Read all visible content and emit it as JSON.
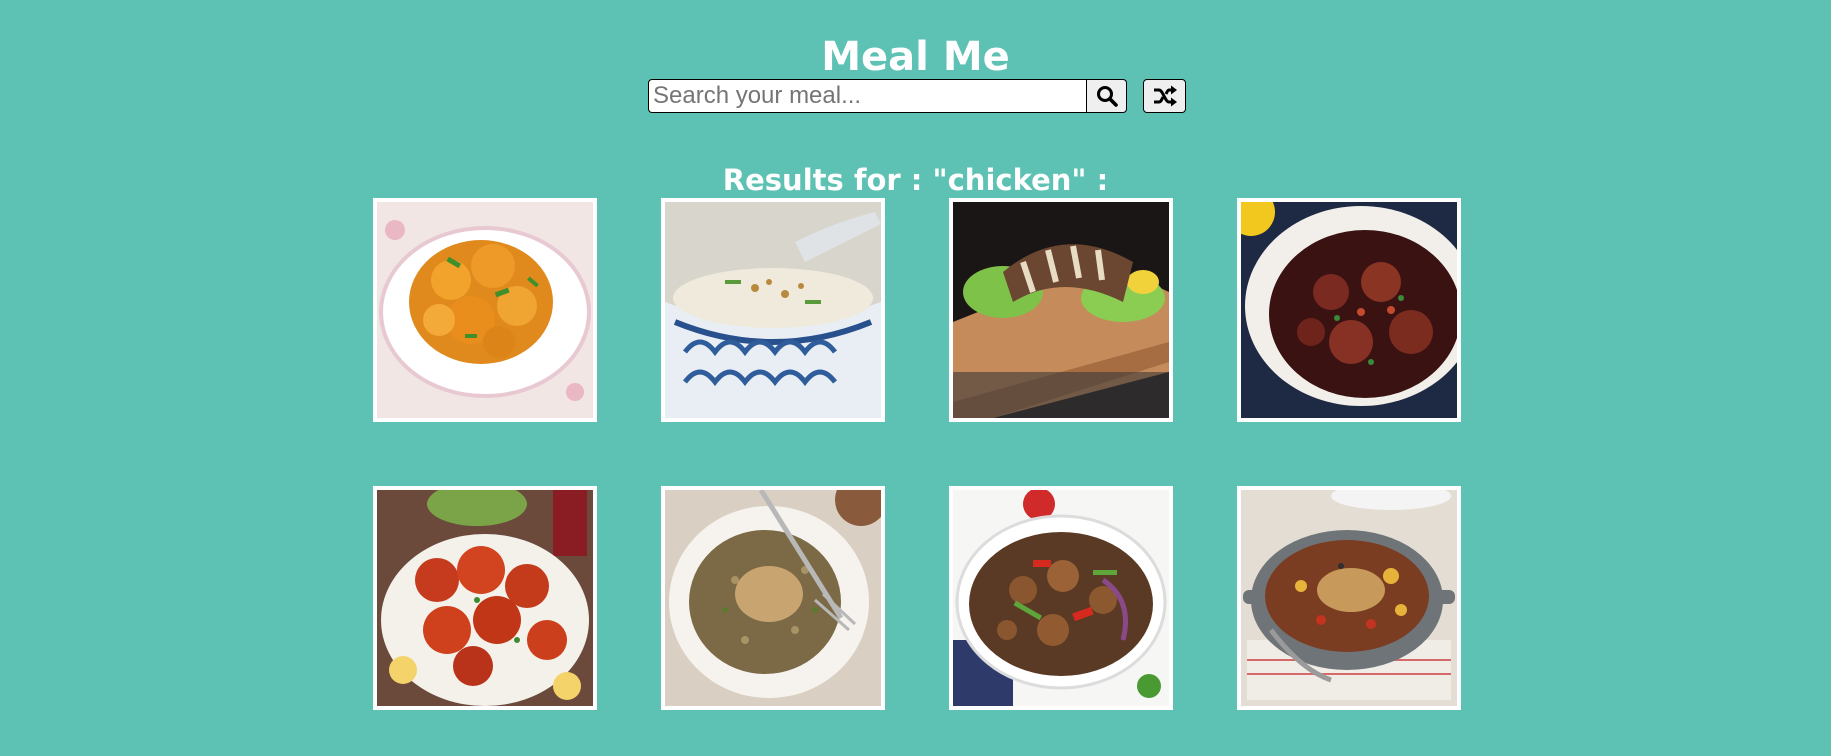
{
  "header": {
    "title": "Meal Me"
  },
  "search": {
    "placeholder": "Search your meal...",
    "value": "",
    "search_icon": "search-icon",
    "random_icon": "shuffle-icon"
  },
  "results": {
    "heading": "Results for : \"chicken\" :"
  },
  "colors": {
    "background": "#5dc1b4",
    "text": "#ffffff",
    "card_border": "#ffffff"
  },
  "meals": [
    {
      "image": "chicken-curry-dish-photo"
    },
    {
      "image": "chicken-congee-bowl-photo"
    },
    {
      "image": "grilled-chicken-on-board-photo"
    },
    {
      "image": "chicken-stew-pot-photo"
    },
    {
      "image": "tandoori-chicken-platter-photo"
    },
    {
      "image": "chicken-with-grains-photo"
    },
    {
      "image": "chicken-stir-fry-bowl-photo"
    },
    {
      "image": "chicken-casserole-pan-photo"
    }
  ]
}
